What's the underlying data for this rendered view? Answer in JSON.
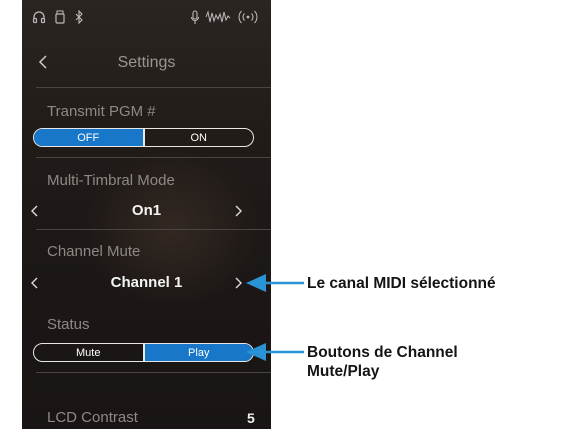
{
  "header": {
    "title": "Settings"
  },
  "transmit_pgm": {
    "label": "Transmit PGM #",
    "off": "OFF",
    "on": "ON",
    "selected": "OFF"
  },
  "multi_timbral": {
    "label": "Multi-Timbral Mode",
    "value": "On1"
  },
  "channel_mute": {
    "label": "Channel Mute",
    "value": "Channel 1"
  },
  "status": {
    "label": "Status",
    "mute": "Mute",
    "play": "Play",
    "selected": "Play"
  },
  "lcd_contrast": {
    "label": "LCD Contrast",
    "value": "5"
  },
  "annotations": {
    "selected_channel": "Le canal MIDI sélectionné",
    "mute_play_buttons_line1": "Boutons de Channel",
    "mute_play_buttons_line2": "Mute/Play"
  },
  "colors": {
    "accent": "#1877c8",
    "callout": "#2a93d5",
    "background": "#1d1816"
  },
  "icons": [
    "headphones-icon",
    "usb-icon",
    "bluetooth-icon",
    "microphone-icon",
    "audio-recorder-icon",
    "wireless-icon",
    "back-chevron-icon",
    "chevron-left-icon",
    "chevron-right-icon"
  ]
}
